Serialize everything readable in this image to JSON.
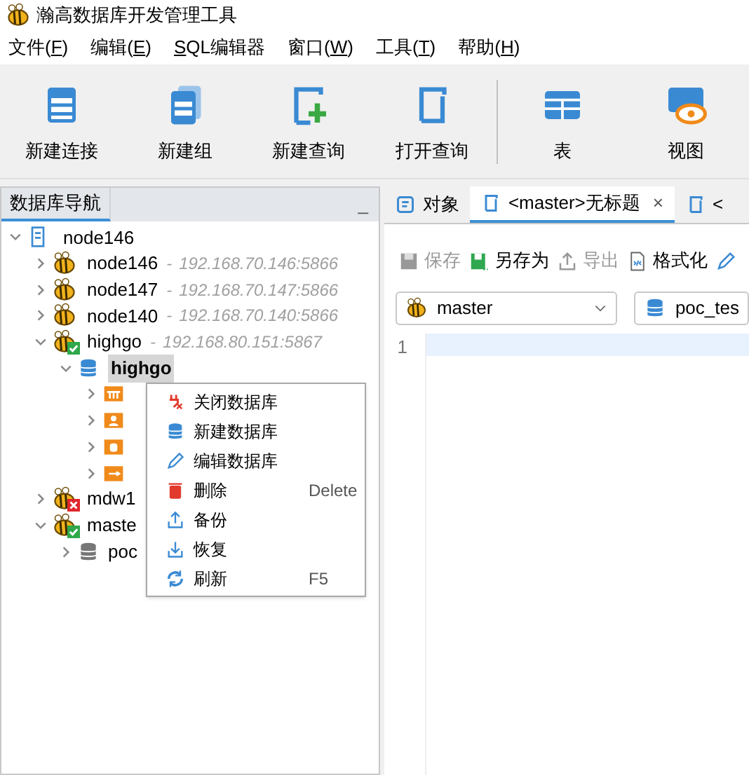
{
  "window": {
    "title": "瀚高数据库开发管理工具"
  },
  "menu": [
    {
      "label": "文件(",
      "key": "F",
      "end": ")"
    },
    {
      "label": "编辑(",
      "key": "E",
      "end": ")"
    },
    {
      "key": "S",
      "end": "QL编辑器"
    },
    {
      "label": "窗口(",
      "key": "W",
      "end": ")"
    },
    {
      "label": "工具(",
      "key": "T",
      "end": ")"
    },
    {
      "label": "帮助(",
      "key": "H",
      "end": ")"
    }
  ],
  "toolbar": [
    {
      "label": "新建连接"
    },
    {
      "label": "新建组"
    },
    {
      "label": "新建查询"
    },
    {
      "label": "打开查询"
    },
    {
      "label": "表"
    },
    {
      "label": "视图"
    }
  ],
  "navigator": {
    "title": "数据库导航",
    "minimize": "_",
    "tree": [
      {
        "kind": "group",
        "label": "node146",
        "expanded": true,
        "children": [
          {
            "kind": "connection",
            "label": "node146",
            "separator": "-",
            "address": "192.168.70.146:5866",
            "connected": false,
            "failed": false,
            "expanded": false
          },
          {
            "kind": "connection",
            "label": "node147",
            "separator": "-",
            "address": "192.168.70.147:5866",
            "connected": false,
            "failed": false,
            "expanded": false
          },
          {
            "kind": "connection",
            "label": "node140",
            "separator": "-",
            "address": "192.168.70.140:5866",
            "connected": false,
            "failed": false,
            "expanded": false
          },
          {
            "kind": "connection",
            "label": "highgo",
            "separator": "-",
            "address": "192.168.80.151:5867",
            "connected": true,
            "failed": false,
            "expanded": true,
            "children": [
              {
                "kind": "database",
                "label": "highgo",
                "selected": true,
                "inactive": false,
                "expanded": true,
                "children": [
                  {
                    "kind": "folder",
                    "expanded": false
                  },
                  {
                    "kind": "folder",
                    "expanded": false
                  },
                  {
                    "kind": "folder",
                    "expanded": false
                  },
                  {
                    "kind": "folder",
                    "expanded": false
                  }
                ]
              }
            ]
          },
          {
            "kind": "connection",
            "label": "mdw1",
            "connected": false,
            "failed": true,
            "expanded": false
          },
          {
            "kind": "connection",
            "label": "maste",
            "connected": true,
            "failed": false,
            "expanded": true,
            "children": [
              {
                "kind": "database",
                "label": "poc",
                "selected": false,
                "inactive": true,
                "expanded": false
              }
            ]
          }
        ]
      }
    ]
  },
  "context_menu": [
    {
      "label": "关闭数据库"
    },
    {
      "label": "新建数据库"
    },
    {
      "label": "编辑数据库"
    },
    {
      "label": "删除",
      "shortcut": "Delete"
    },
    {
      "label": "备份"
    },
    {
      "label": "恢复"
    },
    {
      "label": "刷新",
      "shortcut": "F5"
    }
  ],
  "tabs": [
    {
      "label": "对象",
      "selected": false
    },
    {
      "label": "<master>无标题",
      "selected": true,
      "close": "×"
    },
    {
      "label": "<",
      "selected": false
    }
  ],
  "editor_toolbar": [
    {
      "label": "保存",
      "disabled": true
    },
    {
      "label": "另存为",
      "disabled": false
    },
    {
      "label": "导出",
      "disabled": true
    },
    {
      "label": "格式化",
      "disabled": false
    }
  ],
  "selectors": [
    {
      "value": "master"
    },
    {
      "value": "poc_tes"
    }
  ],
  "editor": {
    "line_numbers": [
      "1"
    ]
  }
}
